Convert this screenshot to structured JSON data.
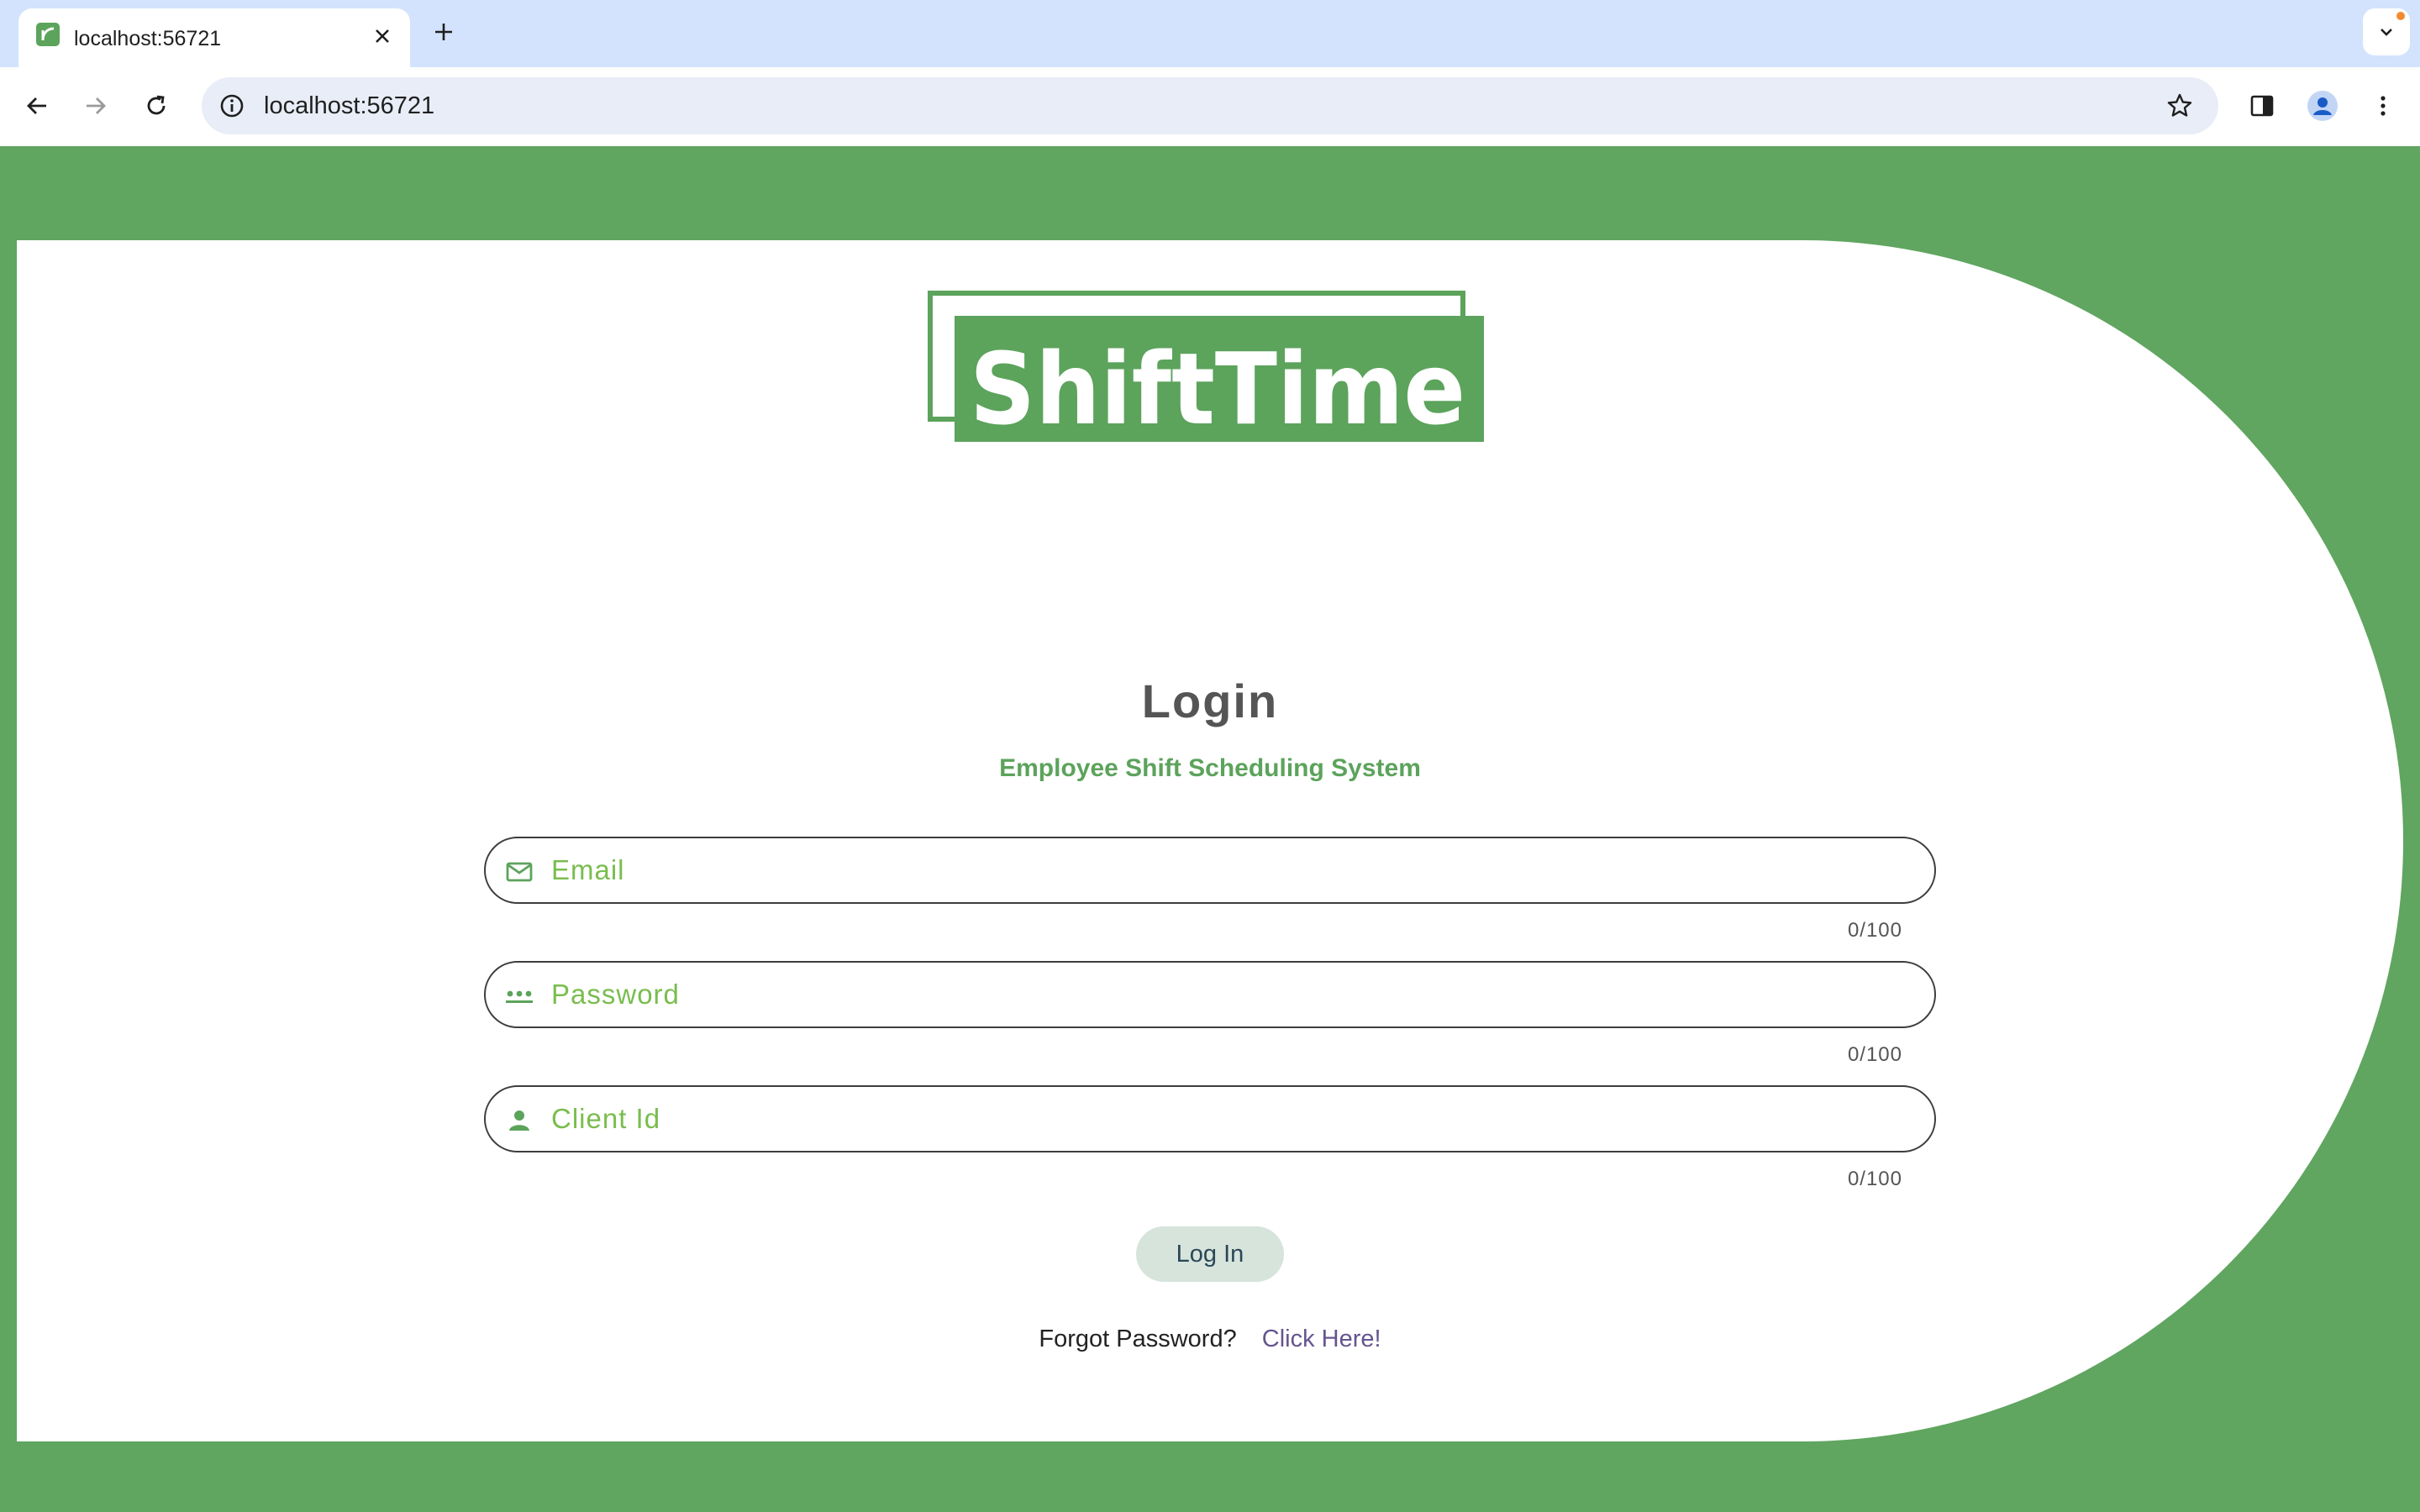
{
  "browser": {
    "tab_title": "localhost:56721",
    "url": "localhost:56721"
  },
  "logo": {
    "text": "ShiftTime",
    "color": "#5ca35c"
  },
  "login": {
    "title": "Login",
    "subtitle": "Employee Shift Scheduling System",
    "fields": [
      {
        "placeholder": "Email",
        "value": "",
        "counter": "0/100",
        "icon": "mail-icon"
      },
      {
        "placeholder": "Password",
        "value": "",
        "counter": "0/100",
        "icon": "password-dots-icon"
      },
      {
        "placeholder": "Client Id",
        "value": "",
        "counter": "0/100",
        "icon": "person-icon"
      }
    ],
    "submit_label": "Log In",
    "forgot_text": "Forgot Password?",
    "forgot_link": "Click Here!"
  },
  "colors": {
    "background_green": "#60a560",
    "accent_green": "#5ca35c",
    "placeholder_green": "#79bd4e",
    "link_purple": "#65558f",
    "button_bg": "#d6e4dc"
  }
}
